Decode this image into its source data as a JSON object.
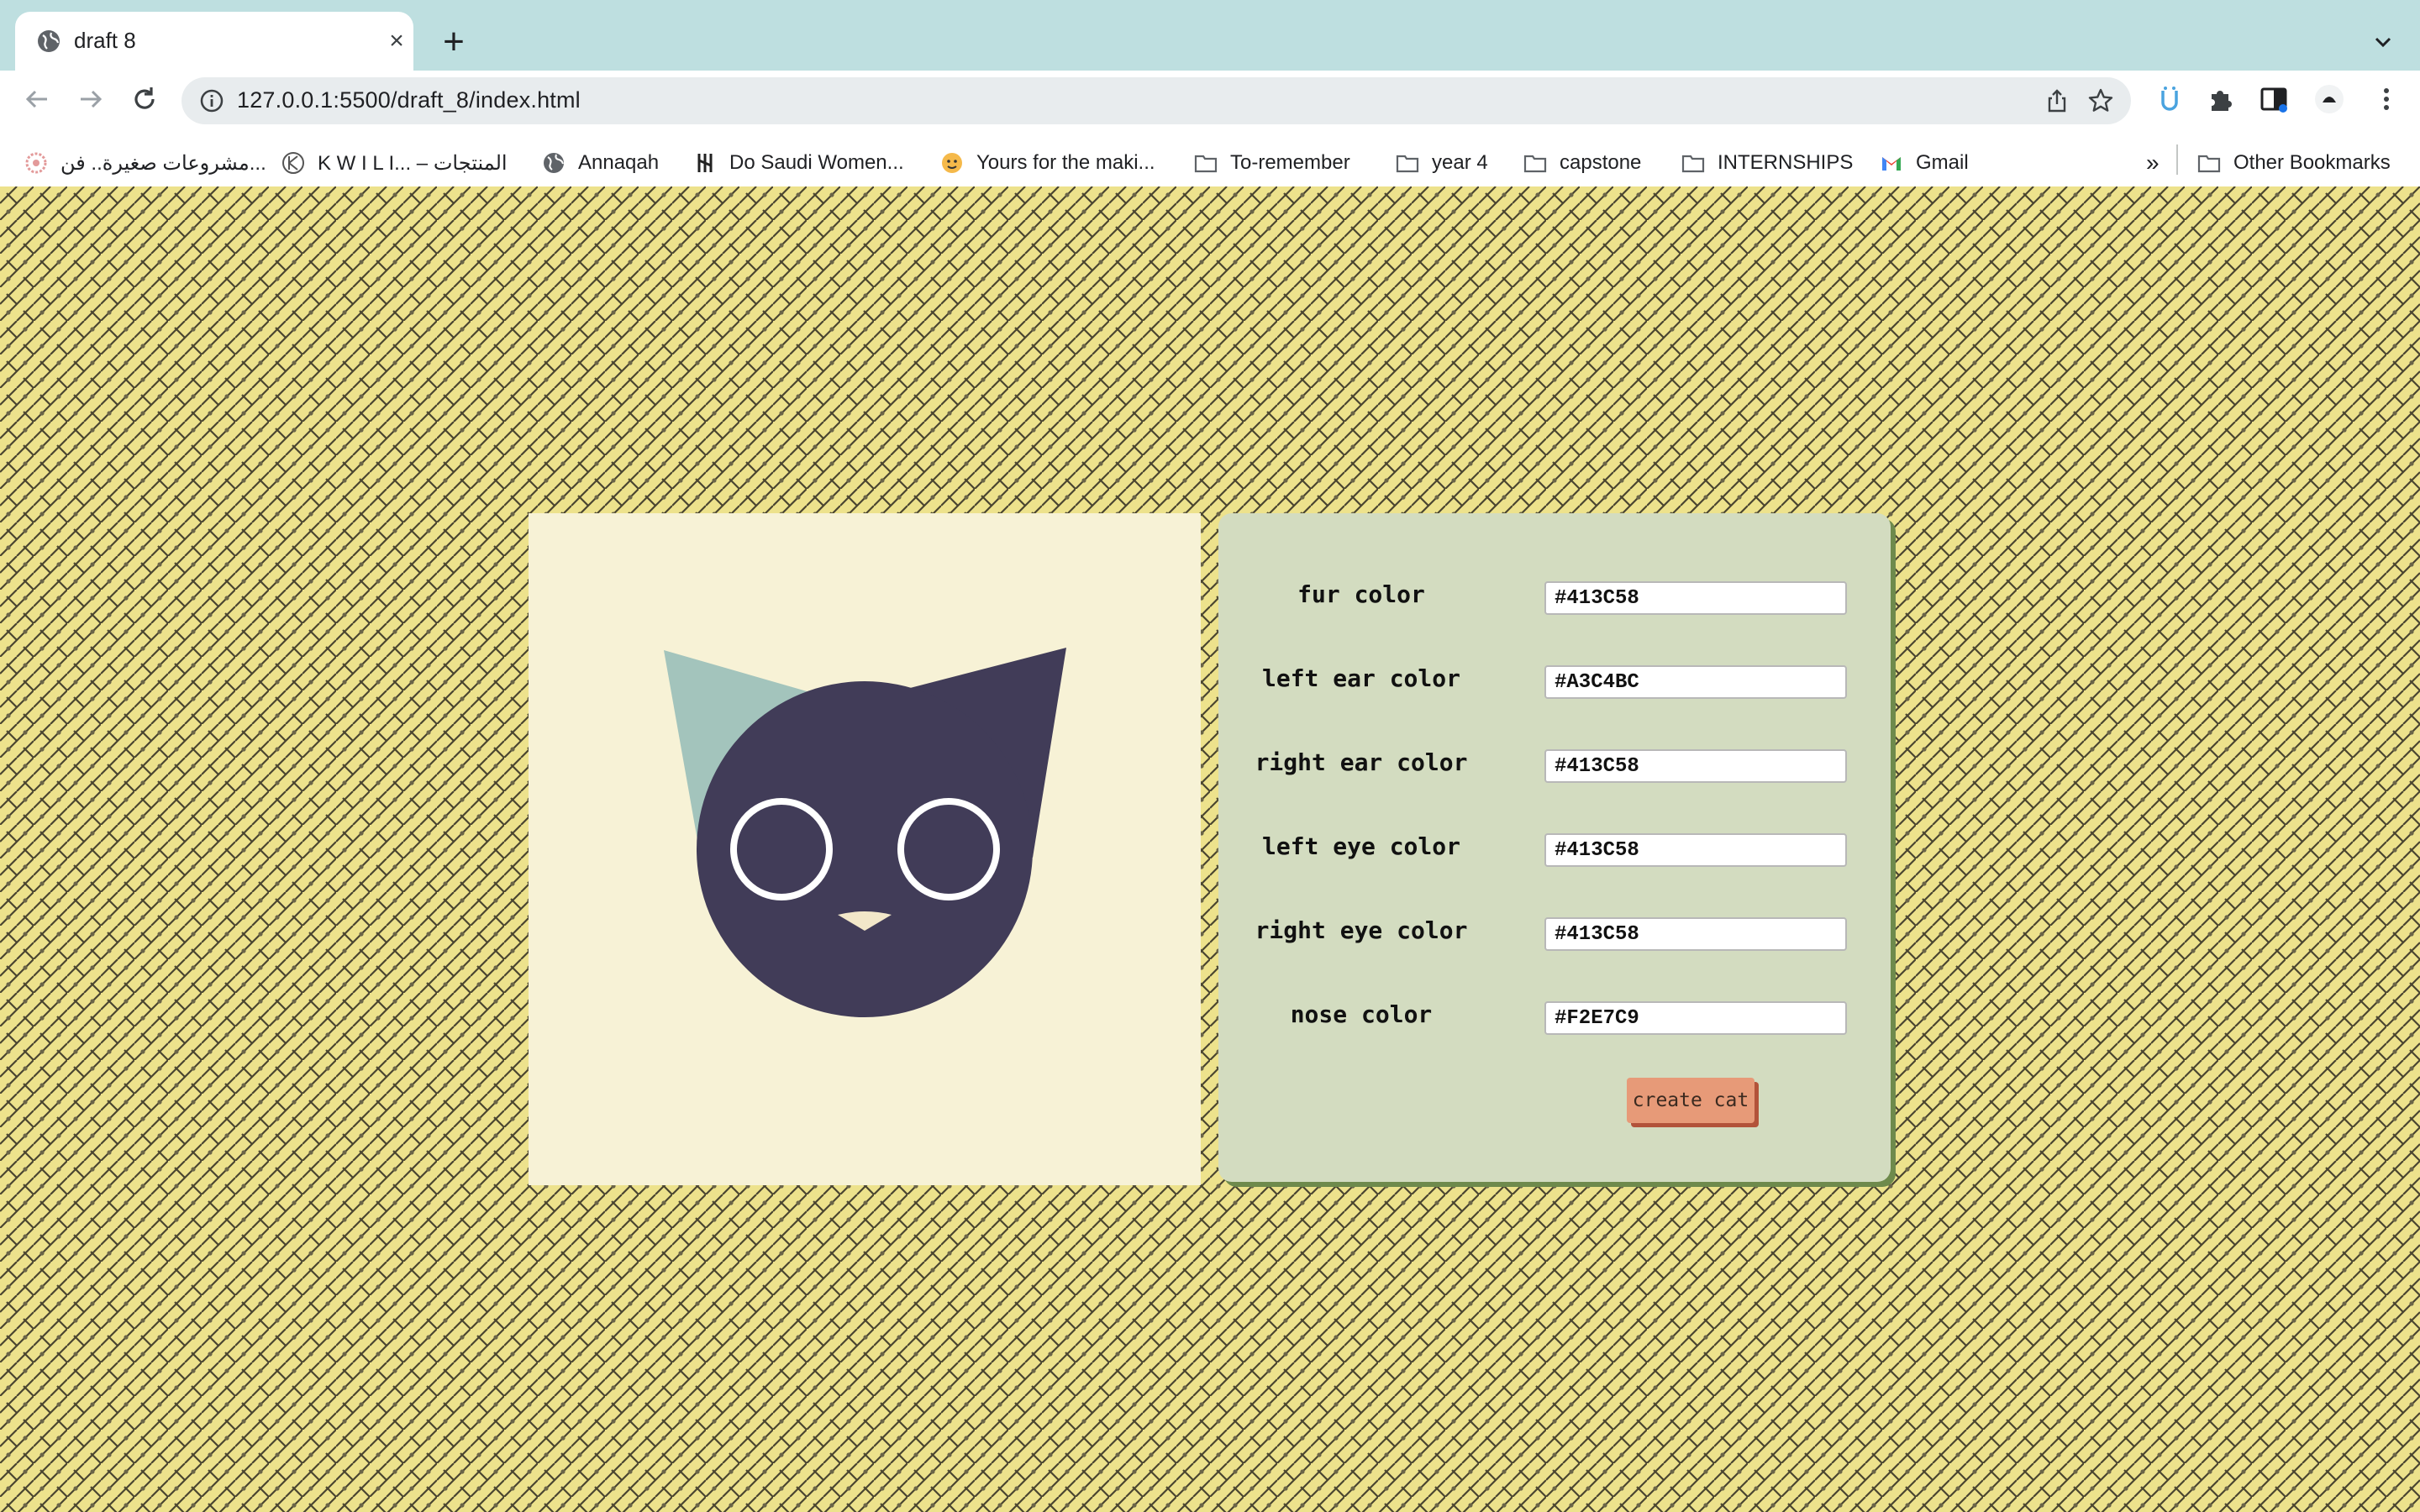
{
  "browser": {
    "tab": {
      "title": "draft 8"
    },
    "address_bar": {
      "url": "127.0.0.1:5500/draft_8/index.html"
    },
    "bookmarks": [
      {
        "label": "مشروعات صغيرة.. فن...",
        "icon": "flower-icon"
      },
      {
        "label": "K W I L I... – المنتجات",
        "icon": "kwili-logo-icon"
      },
      {
        "label": "Annaqah",
        "icon": "globe-icon"
      },
      {
        "label": "Do Saudi Women...",
        "icon": "women-icon"
      },
      {
        "label": "Yours for the maki...",
        "icon": "emoji-icon"
      },
      {
        "label": "To-remember",
        "icon": "folder-icon"
      },
      {
        "label": "year 4",
        "icon": "folder-icon"
      },
      {
        "label": "capstone",
        "icon": "folder-icon"
      },
      {
        "label": "INTERNSHIPS",
        "icon": "folder-icon"
      },
      {
        "label": "Gmail",
        "icon": "gmail-icon"
      }
    ],
    "overflow_label": "»",
    "other_bookmarks": "Other Bookmarks"
  },
  "cat": {
    "fur_color": "#413C58",
    "left_ear_color": "#A3C4BC",
    "right_ear_color": "#413C58",
    "left_eye_color": "#413C58",
    "right_eye_color": "#413C58",
    "nose_color": "#F2E7C9",
    "eye_ring_color": "#FFFFFF",
    "background_color": "#F7F2D6"
  },
  "form": {
    "fields": [
      {
        "label": "fur color",
        "value": "#413C58"
      },
      {
        "label": "left ear color",
        "value": "#A3C4BC"
      },
      {
        "label": "right ear color",
        "value": "#413C58"
      },
      {
        "label": "left eye color",
        "value": "#413C58"
      },
      {
        "label": "right eye color",
        "value": "#413C58"
      },
      {
        "label": "nose color",
        "value": "#F2E7C9"
      }
    ],
    "submit_label": "create cat"
  },
  "colors": {
    "page_background": "#EDE28C",
    "form_background": "#D3DCC0",
    "button": "#E79A78"
  }
}
